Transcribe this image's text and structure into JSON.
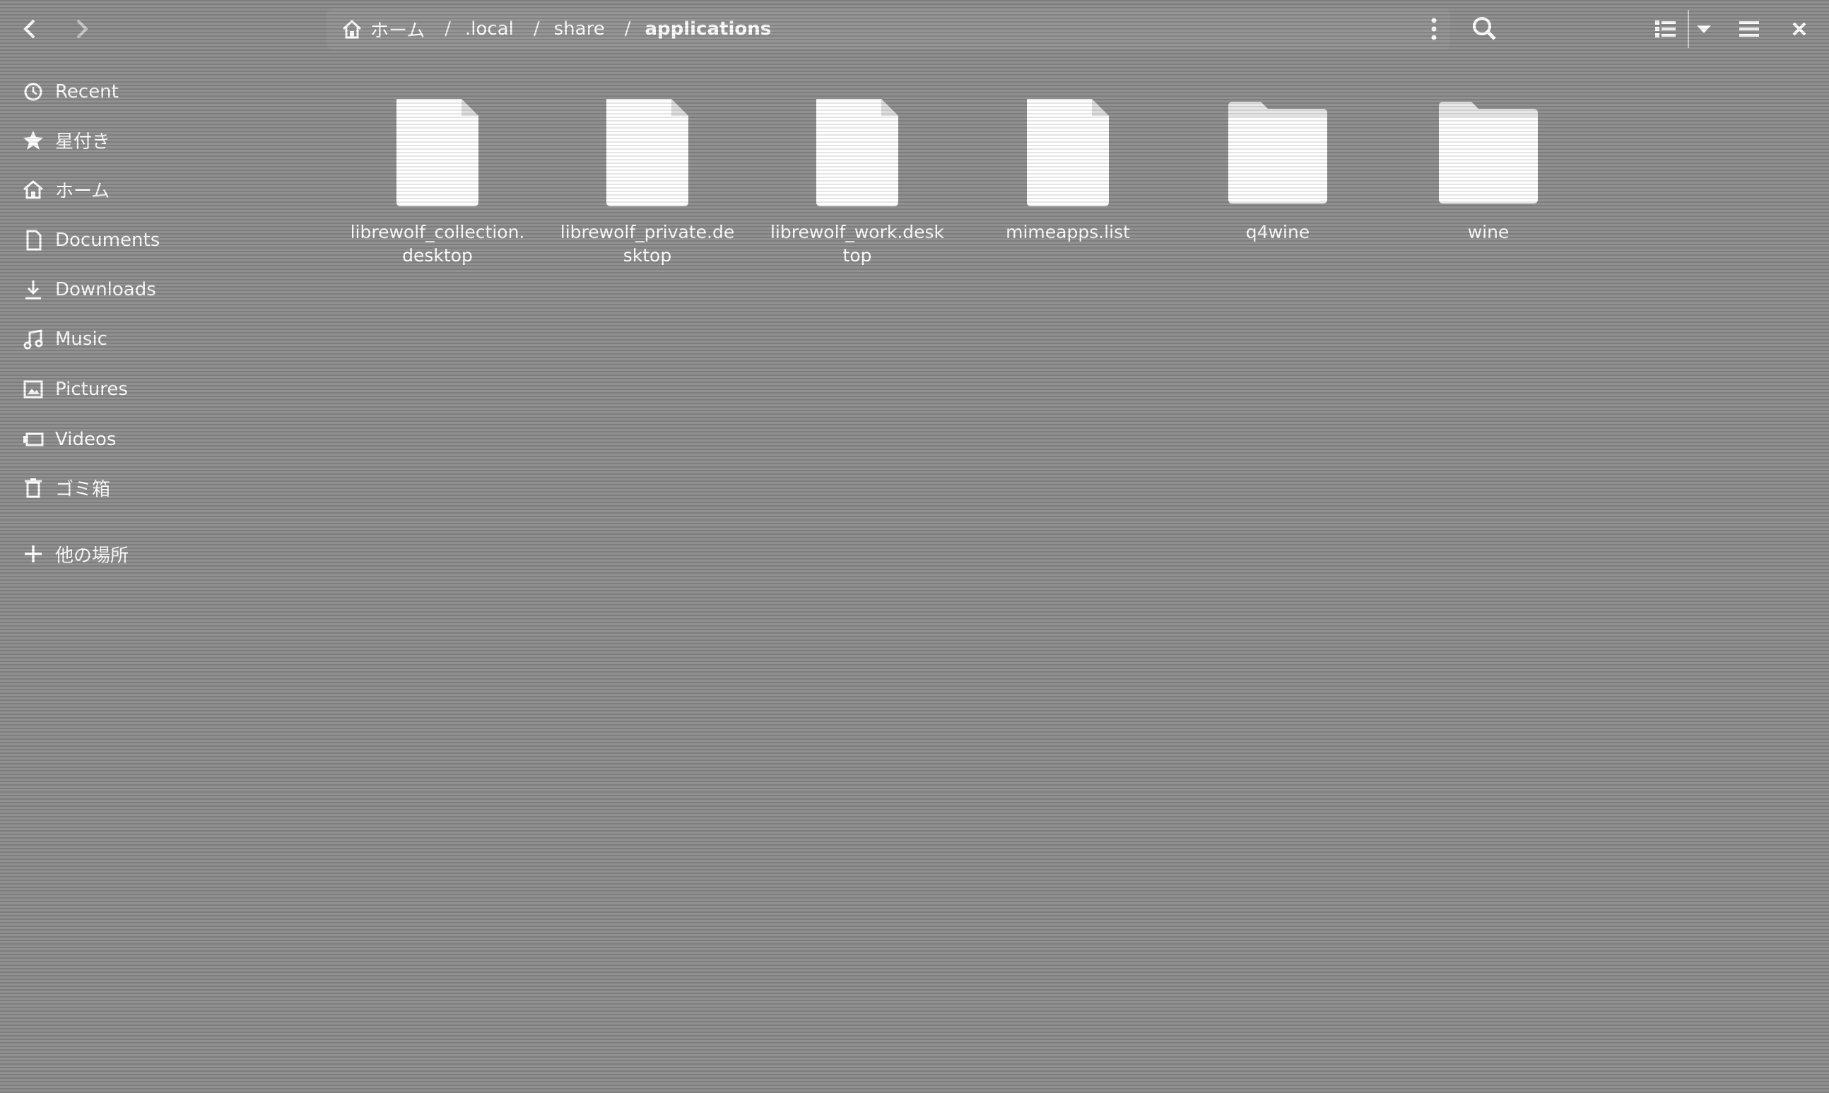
{
  "pathbar": {
    "crumbs": [
      {
        "label": "ホーム",
        "icon": "home-icon"
      },
      {
        "label": ".local"
      },
      {
        "label": "share"
      },
      {
        "label": "applications"
      }
    ],
    "separator": "/"
  },
  "sidebar": {
    "items": [
      {
        "label": "Recent",
        "icon": "clock-icon"
      },
      {
        "label": "星付き",
        "icon": "star-icon"
      },
      {
        "label": "ホーム",
        "icon": "home-icon"
      },
      {
        "label": "Documents",
        "icon": "document-icon"
      },
      {
        "label": "Downloads",
        "icon": "download-icon"
      },
      {
        "label": "Music",
        "icon": "music-icon"
      },
      {
        "label": "Pictures",
        "icon": "picture-icon"
      },
      {
        "label": "Videos",
        "icon": "video-icon"
      },
      {
        "label": "ゴミ箱",
        "icon": "trash-icon"
      },
      {
        "label": "他の場所",
        "icon": "plus-icon"
      }
    ]
  },
  "files": [
    {
      "name": "librewolf_collection.desktop",
      "type": "file"
    },
    {
      "name": "librewolf_private.desktop",
      "type": "file"
    },
    {
      "name": "librewolf_work.desktop",
      "type": "file"
    },
    {
      "name": "mimeapps.list",
      "type": "file"
    },
    {
      "name": "q4wine",
      "type": "folder"
    },
    {
      "name": "wine",
      "type": "folder"
    }
  ]
}
